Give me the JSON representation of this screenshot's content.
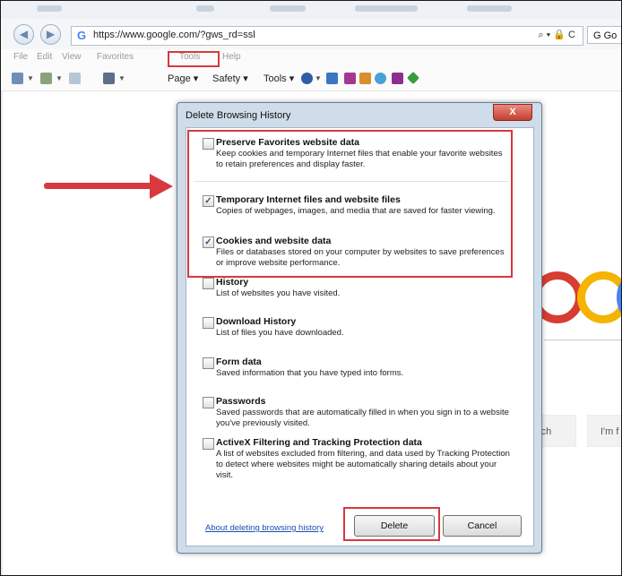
{
  "address_bar": {
    "url": "https://www.google.com/?gws_rd=ssl",
    "controls": "⌕ ▾ 🔒 C",
    "tab_label": "G Go"
  },
  "menu": [
    "File",
    "Edit",
    "View",
    "Favorites",
    "Tools",
    "Help"
  ],
  "command_bar": {
    "page": "Page ▾",
    "safety": "Safety ▾",
    "tools": "Tools ▾"
  },
  "page_behind": {
    "search_btn_partial": "rch",
    "lucky_btn_partial": "I'm f"
  },
  "dialog": {
    "title": "Delete Browsing History",
    "close_label": "X",
    "options": [
      {
        "title": "Preserve Favorites website data",
        "checked": false,
        "desc": "Keep cookies and temporary Internet files that enable your favorite websites to retain preferences and display faster."
      },
      {
        "title": "Temporary Internet files and website files",
        "checked": true,
        "desc": "Copies of webpages, images, and media that are saved for faster viewing."
      },
      {
        "title": "Cookies and website data",
        "checked": true,
        "desc": "Files or databases stored on your computer by websites to save preferences or improve website performance."
      },
      {
        "title": "History",
        "checked": false,
        "desc": "List of websites you have visited."
      },
      {
        "title": "Download History",
        "checked": false,
        "desc": "List of files you have downloaded."
      },
      {
        "title": "Form data",
        "checked": false,
        "desc": "Saved information that you have typed into forms."
      },
      {
        "title": "Passwords",
        "checked": false,
        "desc": "Saved passwords that are automatically filled in when you sign in to a website you've previously visited."
      },
      {
        "title": "ActiveX Filtering and Tracking Protection data",
        "checked": false,
        "desc": "A list of websites excluded from filtering, and data used by Tracking Protection to detect where websites might be automatically sharing details about your visit."
      }
    ],
    "about_link": "About deleting browsing history",
    "delete_label": "Delete",
    "cancel_label": "Cancel"
  },
  "colors": {
    "highlight": "#d8383f",
    "dialog_frame": "#cfdcea",
    "link": "#1a4fb0"
  }
}
